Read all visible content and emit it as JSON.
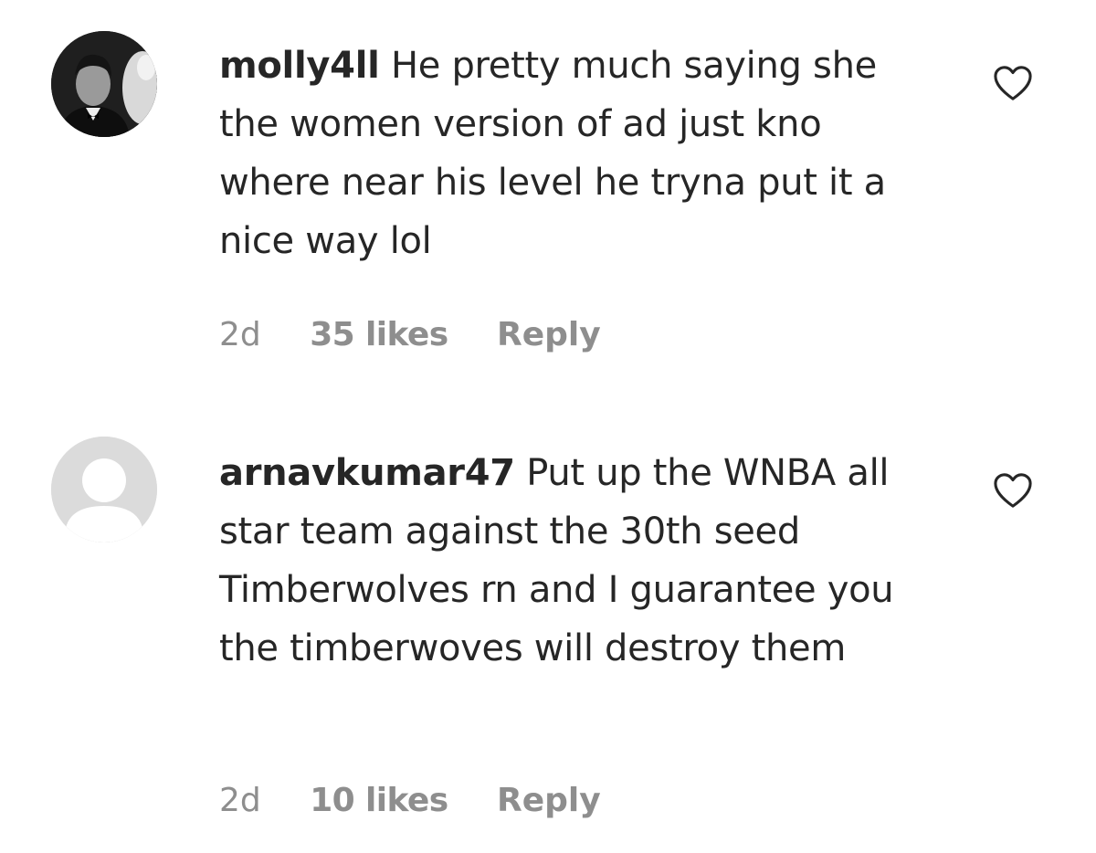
{
  "comments": [
    {
      "username": "molly4ll",
      "text": "He pretty much saying she the women version of ad just kno where near his level he tryna put it a nice way lol",
      "time": "2d",
      "likes": "35 likes",
      "reply_label": "Reply",
      "avatar": "profile-photo",
      "like_icon": "heart-outline-icon"
    },
    {
      "username": "arnavkumar47",
      "text": "Put up the WNBA all star team against the 30th seed Timberwolves rn and I guarantee you the timberwoves will destroy them",
      "time": "2d",
      "likes": "10 likes",
      "reply_label": "Reply",
      "avatar": "default-avatar",
      "like_icon": "heart-outline-icon"
    }
  ],
  "colors": {
    "text": "#262626",
    "secondary": "#8e8e8e",
    "default_avatar": "#dbdbdb",
    "background": "#ffffff"
  }
}
